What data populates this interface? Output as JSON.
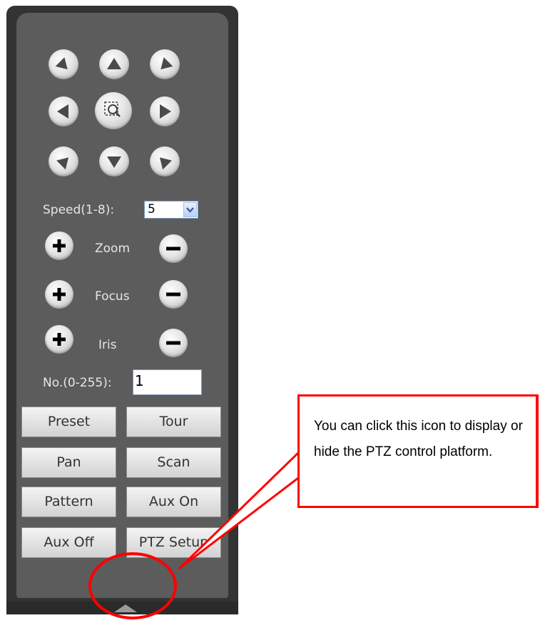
{
  "ptz": {
    "speed_label": "Speed(1-8):",
    "speed_value": "5",
    "zoom_label": "Zoom",
    "focus_label": "Focus",
    "iris_label": "Iris",
    "no_label": "No.(0-255):",
    "no_value": "1",
    "buttons": [
      {
        "label": "Preset"
      },
      {
        "label": "Tour"
      },
      {
        "label": "Pan"
      },
      {
        "label": "Scan"
      },
      {
        "label": "Pattern"
      },
      {
        "label": "Aux On"
      },
      {
        "label": "Aux Off"
      },
      {
        "label": "PTZ Setup"
      }
    ]
  },
  "annotation": {
    "text": "You can click this icon to display or hide the PTZ control platform.",
    "color": "#ff0000"
  },
  "colors": {
    "panel_bg": "#5c5c5c",
    "panel_border": "#333333"
  }
}
